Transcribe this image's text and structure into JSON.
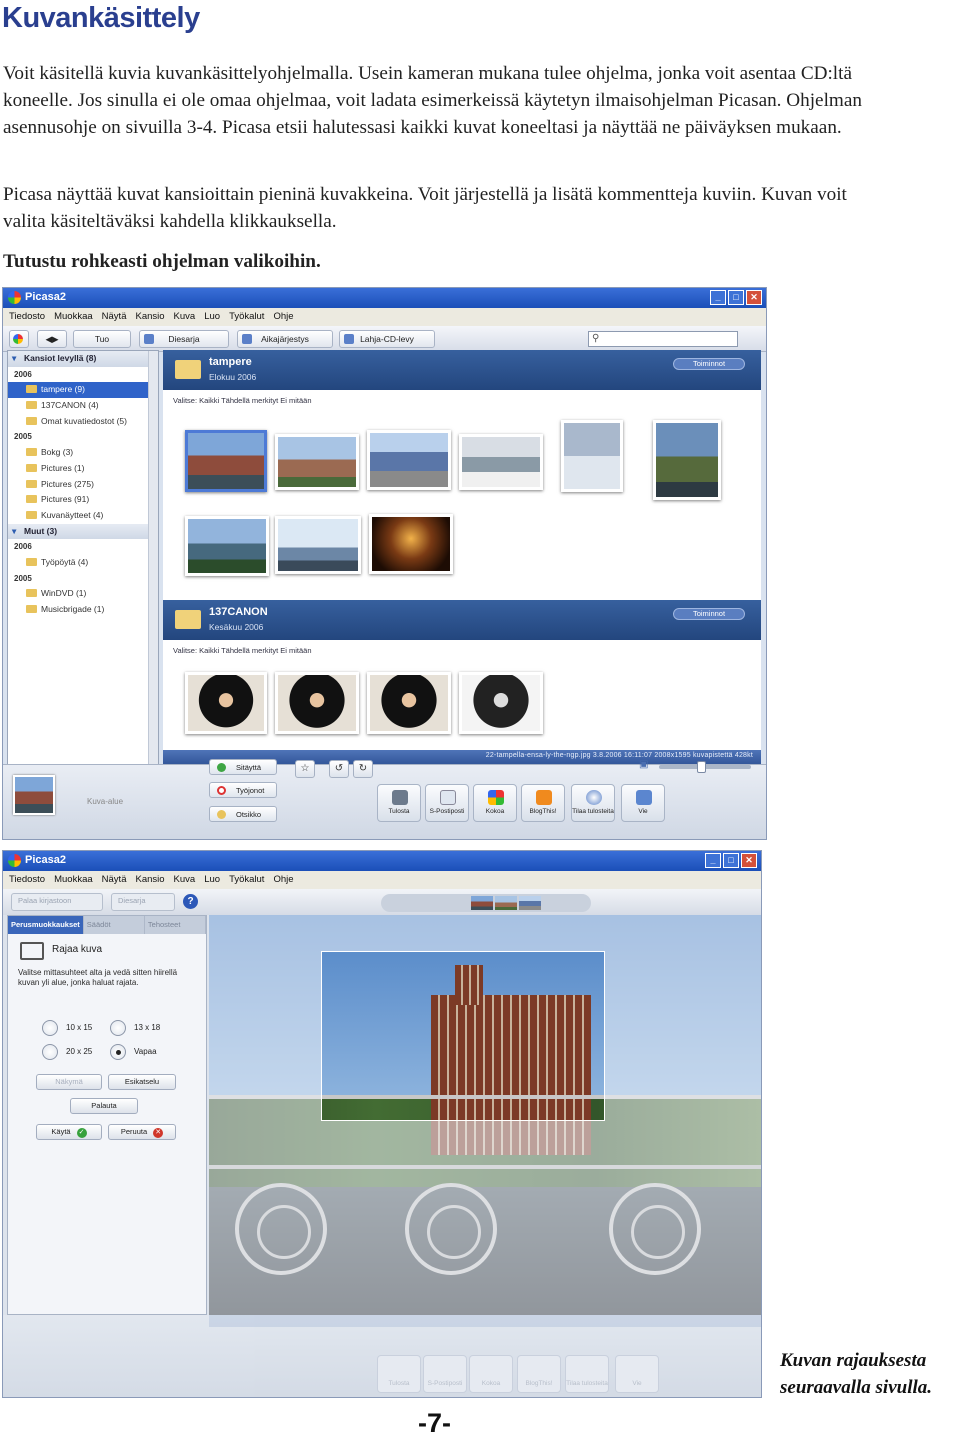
{
  "document": {
    "title": "Kuvankäsittely",
    "paragraphs": [
      "Voit käsitellä kuvia kuvankäsittelyohjelmalla. Usein kameran mukana tulee ohjelma, jonka voit asentaa CD:ltä koneelle. Jos sinulla ei ole omaa ohjelmaa, voit ladata esimerkeissä käytetyn ilmaisohjelman Picasan. Ohjelman asennusohje on sivuilla 3-4. Picasa etsii halutessasi kaikki kuvat koneeltasi ja näyttää ne päiväyksen mukaan.",
      "Picasa näyttää kuvat kansioittain pieninä kuvakkeina. Voit järjestellä ja lisätä kommentteja kuviin. Kuvan voit valita käsiteltäväksi kahdella klikkauksella."
    ],
    "bold_line": "Tutustu rohkeasti ohjelman valikoihin.",
    "caption_line1": "Kuvan rajauksesta",
    "caption_line2": "seuraavalla sivulla.",
    "page_number": "-7-"
  },
  "shot1": {
    "window_title": "Picasa2",
    "menu": [
      "Tiedosto",
      "Muokkaa",
      "Näytä",
      "Kansio",
      "Kuva",
      "Luo",
      "Työkalut",
      "Ohje"
    ],
    "toolbar": [
      "Tuo",
      "Diesarja",
      "Aikajärjestys",
      "Lahja-CD-levy"
    ],
    "sidebar": [
      {
        "kind": "group",
        "label": "Kansiot levyllä (8)"
      },
      {
        "kind": "year",
        "label": "2006"
      },
      {
        "kind": "item",
        "label": "tampere (9)",
        "selected": true
      },
      {
        "kind": "item",
        "label": "137CANON (4)"
      },
      {
        "kind": "item",
        "label": "Omat kuvatiedostot (5)"
      },
      {
        "kind": "year",
        "label": "2005"
      },
      {
        "kind": "item",
        "label": "Bokg (3)"
      },
      {
        "kind": "item",
        "label": "Pictures (1)"
      },
      {
        "kind": "item",
        "label": "Pictures (275)"
      },
      {
        "kind": "item",
        "label": "Pictures (91)"
      },
      {
        "kind": "item",
        "label": "Kuvanäytteet (4)"
      },
      {
        "kind": "group",
        "label": "Muut (3)"
      },
      {
        "kind": "year",
        "label": "2006"
      },
      {
        "kind": "item",
        "label": "Työpöytä (4)"
      },
      {
        "kind": "year",
        "label": "2005"
      },
      {
        "kind": "item",
        "label": "WinDVD (1)"
      },
      {
        "kind": "item",
        "label": "Musicbrigade (1)"
      }
    ],
    "folders": [
      {
        "name": "tampere",
        "date": "Elokuu 2006",
        "pill": "Toiminnot",
        "select_line": "Valitse: Kaikki Tähdellä merkityt Ei mitään"
      },
      {
        "name": "137CANON",
        "date": "Kesäkuu 2006",
        "pill": "Toiminnot",
        "select_line": "Valitse: Kaikki Tähdellä merkityt Ei mitään"
      }
    ],
    "status": "22-tampella-ensa-ly-the-ngp.jpg   3.8.2006 16:11:07   2008x1595 kuvapistettä   428kt",
    "tray_label": "Kuva-alue",
    "side_buttons": [
      "Sitäyttä",
      "Työjonot",
      "Otsikko"
    ],
    "actions": [
      "Tulosta",
      "S-Postiposti",
      "Kokoa",
      "BlogThis!",
      "Tilaa tulosteita",
      "Vie"
    ],
    "colors": {
      "accent": "#2f63c9",
      "folder_header": "#2b4f8a",
      "title_blue": "#2a3f8f"
    }
  },
  "shot2": {
    "window_title": "Picasa2",
    "menu": [
      "Tiedosto",
      "Muokkaa",
      "Näytä",
      "Kansio",
      "Kuva",
      "Luo",
      "Työkalut",
      "Ohje"
    ],
    "nav_back": "Palaa kirjastoon",
    "nav_slideshow": "Diesarja",
    "tabs": [
      "Perusmuokkaukset",
      "Säädöt",
      "Tehosteet"
    ],
    "crop_title": "Rajaa kuva",
    "crop_help": "Valitse mittasuhteet alta ja vedä sitten hiirellä kuvan yli alue, jonka haluat rajata.",
    "ratios": [
      {
        "label": "10 x 15",
        "on": false
      },
      {
        "label": "13 x 18",
        "on": false
      },
      {
        "label": "20 x 25",
        "on": false
      },
      {
        "label": "Vapaa",
        "on": true
      }
    ],
    "btn_preview": "Näkymä",
    "btn_manual": "Esikatselu",
    "btn_reset": "Palauta",
    "btn_apply": "Käytä",
    "btn_cancel": "Peruuta",
    "actions": [
      "Tulosta",
      "S-Postiposti",
      "Kokoa",
      "BlogThis!",
      "Tilaa tulosteita",
      "Vie"
    ]
  }
}
